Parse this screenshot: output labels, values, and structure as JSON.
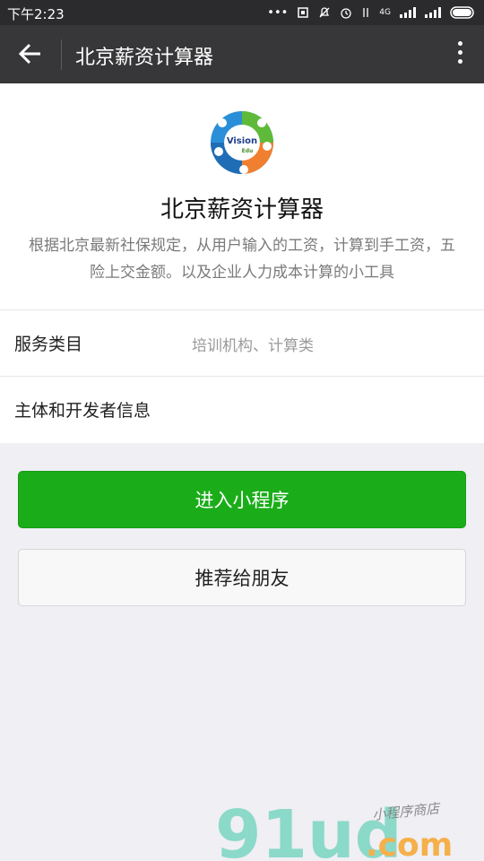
{
  "status_bar": {
    "time": "下午2:23",
    "network_label": "4G"
  },
  "nav": {
    "title": "北京薪资计算器"
  },
  "app": {
    "name": "北京薪资计算器",
    "description": "根据北京最新社保规定，从用户输入的工资，计算到手工资，五险上交金额。以及企业人力成本计算的小工具",
    "logo_text_main": "Vision",
    "logo_text_sub": "Edu"
  },
  "info_rows": [
    {
      "label": "服务类目",
      "value": "培训机构、计算类"
    },
    {
      "label": "主体和开发者信息",
      "value": ""
    }
  ],
  "buttons": {
    "enter": "进入小程序",
    "recommend": "推荐给朋友"
  },
  "watermark": {
    "brand": "91ud",
    "domain": ".com",
    "tagline": "小程序商店"
  },
  "colors": {
    "primary_green": "#1aad19",
    "navbar": "#373739",
    "background": "#efeff4"
  }
}
